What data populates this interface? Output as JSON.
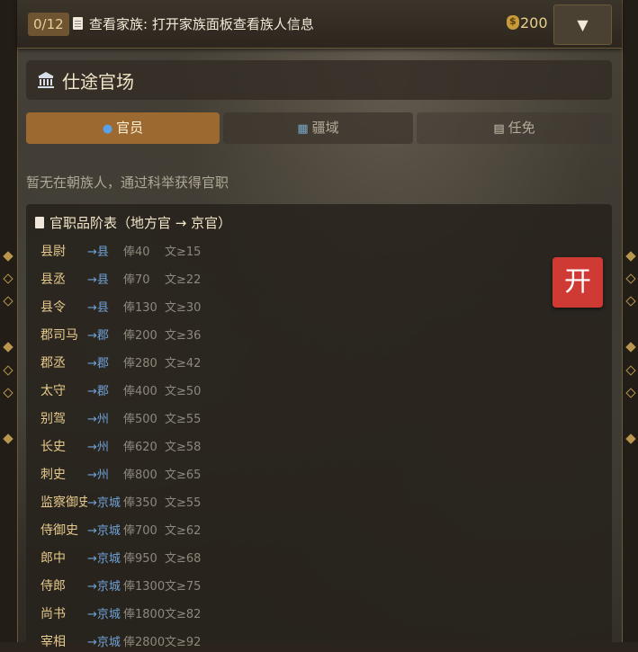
{
  "topbar": {
    "progress": "0/12",
    "task_icon": "document-icon",
    "task_text": "查看家族: 打开家族面板查看族人信息",
    "coin_icon": "money-bag-icon",
    "coins": "200",
    "menu_glyph": "▼"
  },
  "panel": {
    "icon": "temple-icon",
    "title": "仕途官场"
  },
  "tabs": [
    {
      "icon": "person-icon",
      "label": "官员",
      "active": true
    },
    {
      "icon": "map-icon",
      "label": "疆域",
      "active": false
    },
    {
      "icon": "clipboard-icon",
      "label": "任免",
      "active": false
    }
  ],
  "empty_message": "暂无在朝族人，通过科举获得官职",
  "rank_table": {
    "heading": "官职品阶表（地方官 → 京官）",
    "rows": [
      {
        "title": "县尉",
        "loc": "→县",
        "pay": "俸40",
        "lit": "文≥15"
      },
      {
        "title": "县丞",
        "loc": "→县",
        "pay": "俸70",
        "lit": "文≥22"
      },
      {
        "title": "县令",
        "loc": "→县",
        "pay": "俸130",
        "lit": "文≥30"
      },
      {
        "title": "郡司马",
        "loc": "→郡",
        "pay": "俸200",
        "lit": "文≥36"
      },
      {
        "title": "郡丞",
        "loc": "→郡",
        "pay": "俸280",
        "lit": "文≥42"
      },
      {
        "title": "太守",
        "loc": "→郡",
        "pay": "俸400",
        "lit": "文≥50"
      },
      {
        "title": "别驾",
        "loc": "→州",
        "pay": "俸500",
        "lit": "文≥55"
      },
      {
        "title": "长史",
        "loc": "→州",
        "pay": "俸620",
        "lit": "文≥58"
      },
      {
        "title": "刺史",
        "loc": "→州",
        "pay": "俸800",
        "lit": "文≥65"
      },
      {
        "title": "监察御史",
        "loc": "→京城",
        "pay": "俸350",
        "lit": "文≥55"
      },
      {
        "title": "侍御史",
        "loc": "→京城",
        "pay": "俸700",
        "lit": "文≥62"
      },
      {
        "title": "郎中",
        "loc": "→京城",
        "pay": "俸950",
        "lit": "文≥68"
      },
      {
        "title": "侍郎",
        "loc": "→京城",
        "pay": "俸1300",
        "lit": "文≥75"
      },
      {
        "title": "尚书",
        "loc": "→京城",
        "pay": "俸1800",
        "lit": "文≥82"
      },
      {
        "title": "宰相",
        "loc": "→京城",
        "pay": "俸2800",
        "lit": "文≥92"
      }
    ]
  },
  "start_button": "开"
}
